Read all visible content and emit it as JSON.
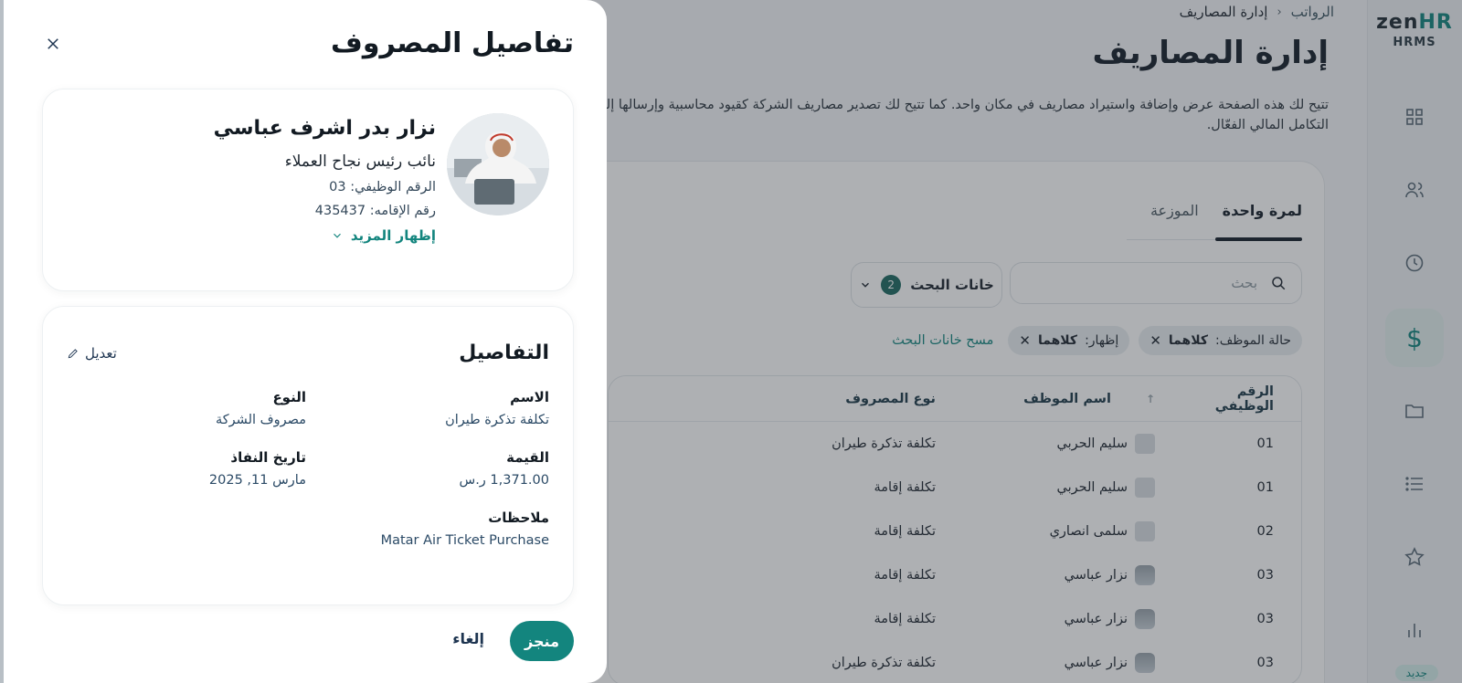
{
  "app": {
    "logo_zen": "zen",
    "logo_hr": "HR",
    "logo_hrms": "HRMS",
    "new_badge": "جديد"
  },
  "sidebar": {
    "items": [
      {
        "name": "dashboard",
        "icon": "grid-icon"
      },
      {
        "name": "employees",
        "icon": "users-icon"
      },
      {
        "name": "attendance",
        "icon": "clock-icon"
      },
      {
        "name": "payroll",
        "icon": "dollar-icon",
        "label": "$",
        "active": true
      },
      {
        "name": "documents",
        "icon": "folder-icon"
      },
      {
        "name": "lists",
        "icon": "list-icon"
      },
      {
        "name": "favorites",
        "icon": "star-icon"
      },
      {
        "name": "reports",
        "icon": "bar-chart-icon"
      }
    ]
  },
  "breadcrumb": {
    "parent": "الرواتب",
    "current": "إدارة المصاريف"
  },
  "page": {
    "title": "إدارة المصاريف",
    "description": "تتيح لك هذه الصفحة عرض وإضافة واستيراد مصاريف في مكان واحد. كما تتيح لك تصدير مصاريف الشركة كقيود محاسبية وإرسالها إلى التكامل المالي الفعّال."
  },
  "tabs": [
    {
      "label": "لمرة واحدة",
      "active": true
    },
    {
      "label": "الموزعة",
      "active": false
    }
  ],
  "search": {
    "placeholder": "بحث",
    "filters_label": "خانات البحث",
    "filters_count": "2"
  },
  "chips": [
    {
      "key": "حالة الموظف:",
      "value": "كلاهما"
    },
    {
      "key": "إظهار:",
      "value": "كلاهما"
    }
  ],
  "clear_filters": "مسح خانات البحث",
  "table": {
    "headers": {
      "id": "الرقم الوظيفي",
      "name": "اسم الموظف",
      "type": "نوع المصروف"
    },
    "rows": [
      {
        "id": "01",
        "name": "سليم الحربي",
        "type": "تكلفة تذكرة طيران"
      },
      {
        "id": "01",
        "name": "سليم الحربي",
        "type": "تكلفة إقامة"
      },
      {
        "id": "02",
        "name": "سلمى انصاري",
        "type": "تكلفة إقامة"
      },
      {
        "id": "03",
        "name": "نزار عباسي",
        "type": "تكلفة إقامة"
      },
      {
        "id": "03",
        "name": "نزار عباسي",
        "type": "تكلفة إقامة"
      },
      {
        "id": "03",
        "name": "نزار عباسي",
        "type": "تكلفة تذكرة طيران"
      }
    ]
  },
  "drawer": {
    "title": "تفاصيل المصروف",
    "employee": {
      "name": "نزار بدر اشرف عباسي",
      "role": "نائب رئيس نجاح العملاء",
      "employee_id": "الرقم الوظيفي: 03",
      "iqama": "رقم الإقامه: 435437",
      "show_more": "إظهار المزيد"
    },
    "details": {
      "title": "التفاصيل",
      "edit": "تعديل",
      "name_label": "الاسم",
      "name_value": "تكلفة تذكرة طيران",
      "type_label": "النوع",
      "type_value": "مصروف الشركة",
      "amount_label": "القيمة",
      "amount_value": "1,371.00 ر.س",
      "date_label": "تاريخ النفاذ",
      "date_value": "مارس 11, 2025",
      "notes_label": "ملاحظات",
      "notes_value": "Matar Air Ticket Purchase"
    },
    "done": "منجز",
    "cancel": "إلغاء"
  }
}
